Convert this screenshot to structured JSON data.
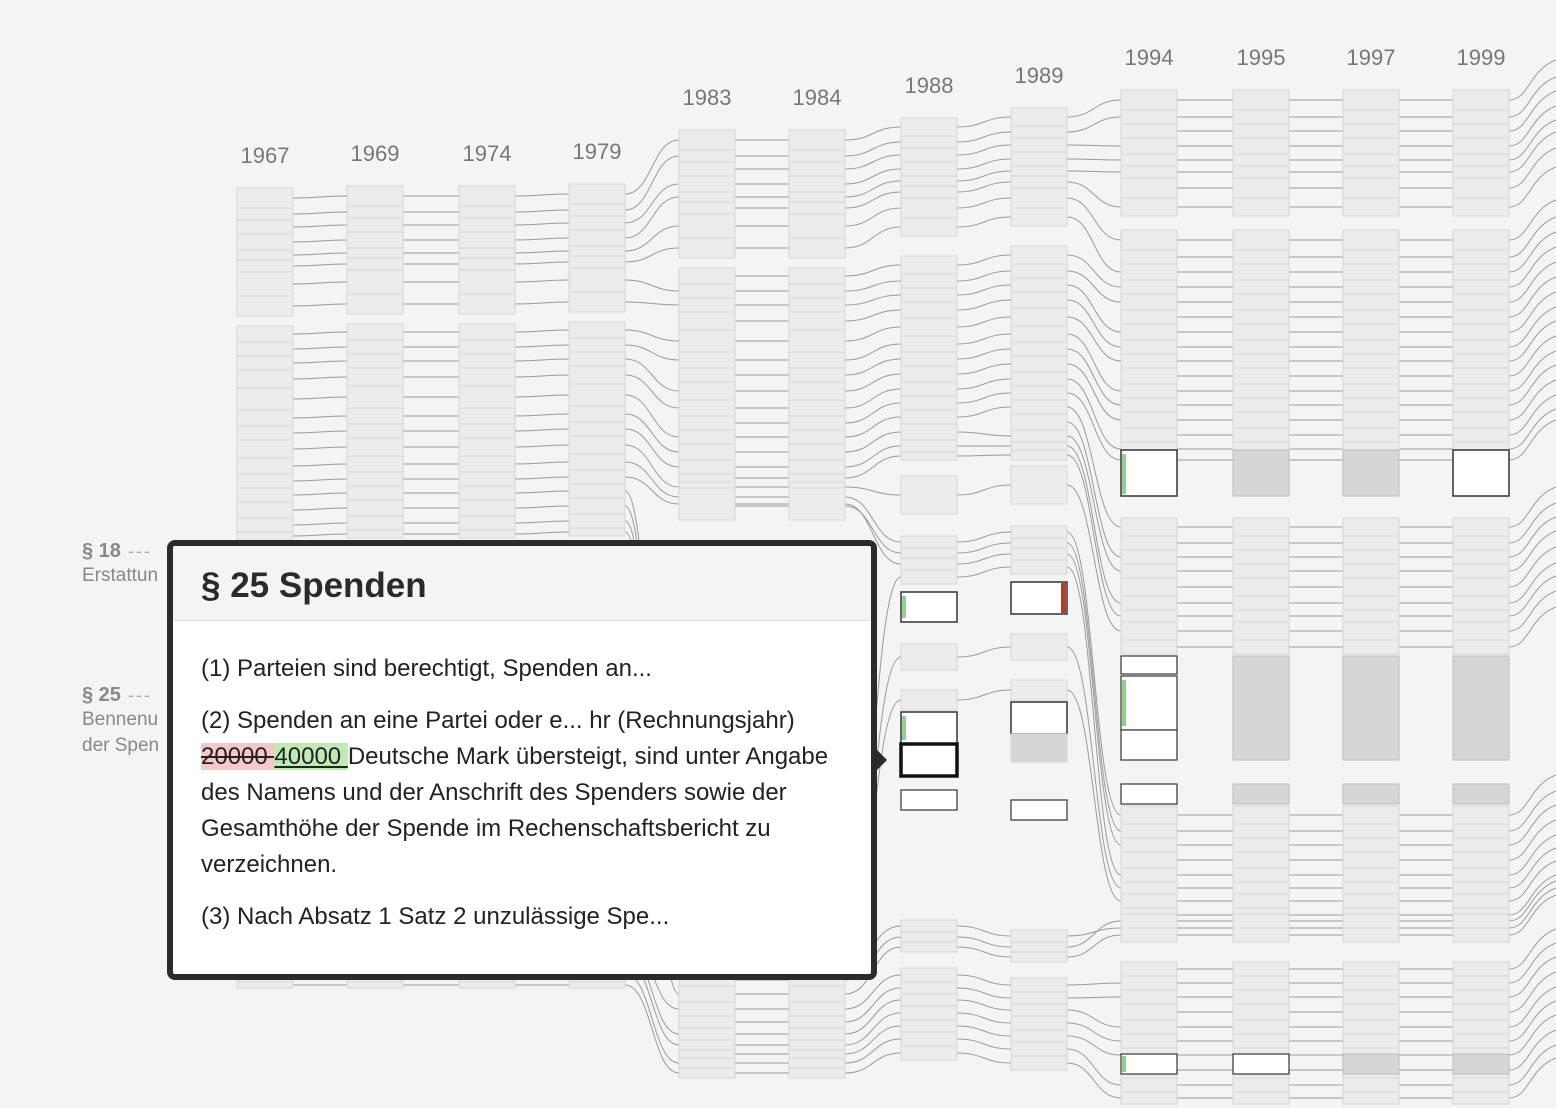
{
  "years": [
    "1967",
    "1969",
    "1974",
    "1979",
    "1983",
    "1984",
    "1988",
    "1989",
    "1994",
    "1995",
    "1997",
    "1999"
  ],
  "side_labels": [
    {
      "number": "§ 18",
      "title_lines": [
        "Erstattun"
      ]
    },
    {
      "number": "§ 25",
      "title_lines": [
        "Bennenu",
        "der Spen"
      ]
    }
  ],
  "popup": {
    "title": "§ 25 Spenden",
    "para1": "(1) Parteien sind berechtigt, Spenden an...",
    "para2_lead": "(2) Spenden an eine Partei oder e... hr (Rechnungsjahr)",
    "para2_removed": "20000 ",
    "para2_added": "40000 ",
    "para2_rest": "Deutsche Mark übersteigt, sind unter Angabe des Namens und der Anschrift des Spenders sowie der Gesamthöhe der Spende im Rechenschaftsbericht zu verzeichnen.",
    "para3": "(3) Nach Absatz 1 Satz 2 unzulässige Spe..."
  },
  "colors": {
    "background": "#f4f4f4",
    "block_fill": "#ececec",
    "block_stroke": "#d6d6d6",
    "highlight_fill": "#ffffff",
    "highlight_stroke": "#333333",
    "changed_fill": "#d6d6d6",
    "insertion_mark": "#8fd18a",
    "deletion_mark": "#b5412c"
  }
}
